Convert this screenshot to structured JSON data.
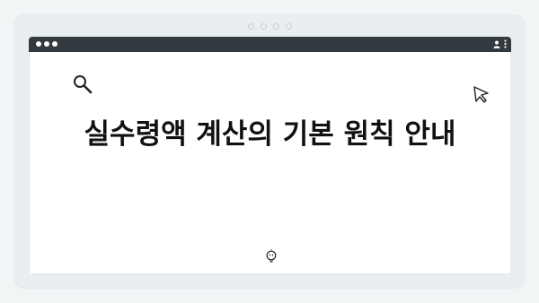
{
  "heading": "실수령액 계산의 기본 원칙 안내",
  "icons": {
    "search": "magnifier-icon",
    "cursor": "mouse-pointer-icon",
    "bulb": "lightbulb-icon",
    "user": "user-icon",
    "menu": "kebab-menu-icon"
  },
  "colors": {
    "titlebar": "#333a3f",
    "background": "#f2f5f6",
    "content": "#ffffff",
    "text": "#111111"
  }
}
